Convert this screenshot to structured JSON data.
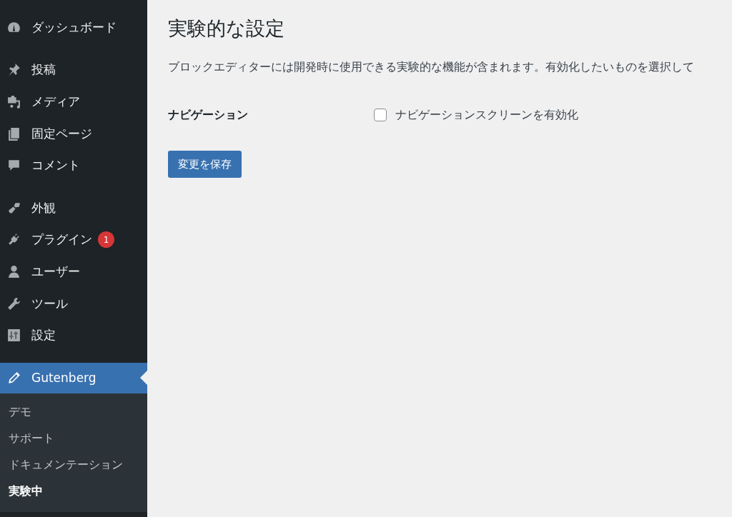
{
  "sidebar": {
    "groups": [
      {
        "items": [
          {
            "label": "ダッシュボード",
            "selected": false
          }
        ]
      },
      {
        "items": [
          {
            "label": "投稿",
            "selected": false
          },
          {
            "label": "メディア",
            "selected": false
          },
          {
            "label": "固定ページ",
            "selected": false
          },
          {
            "label": "コメント",
            "selected": false
          }
        ]
      },
      {
        "items": [
          {
            "label": "外観",
            "selected": false
          },
          {
            "label": "プラグイン",
            "selected": false,
            "badge": "1"
          },
          {
            "label": "ユーザー",
            "selected": false
          },
          {
            "label": "ツール",
            "selected": false
          },
          {
            "label": "設定",
            "selected": false
          }
        ]
      },
      {
        "items": [
          {
            "label": "Gutenberg",
            "selected": true
          }
        ]
      }
    ],
    "submenu": [
      {
        "label": "デモ",
        "selected": false
      },
      {
        "label": "サポート",
        "selected": false
      },
      {
        "label": "ドキュメンテーション",
        "selected": false
      },
      {
        "label": "実験中",
        "selected": true
      }
    ]
  },
  "page": {
    "title": "実験的な設定",
    "description": "ブロックエディターには開発時に使用できる実験的な機能が含まれます。有効化したいものを選択して",
    "settings": [
      {
        "label": "ナビゲーション",
        "option": "ナビゲーションスクリーンを有効化",
        "checked": false
      }
    ],
    "save_button": "変更を保存"
  }
}
